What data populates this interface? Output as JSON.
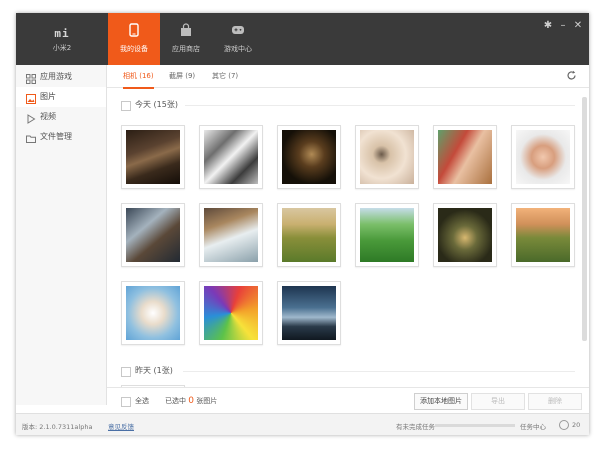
{
  "device": {
    "logo": "mi",
    "name": "小米2"
  },
  "nav": [
    {
      "label": "我的设备",
      "icon": "phone-icon",
      "active": true
    },
    {
      "label": "应用商店",
      "icon": "bag-icon",
      "active": false
    },
    {
      "label": "游戏中心",
      "icon": "gamepad-icon",
      "active": false
    }
  ],
  "window_controls": {
    "settings": "✱",
    "minimize": "–",
    "close": "✕"
  },
  "sidebar": {
    "items": [
      {
        "label": "应用游戏",
        "icon": "apps-grid-icon",
        "active": false
      },
      {
        "label": "图片",
        "icon": "image-icon",
        "active": true
      },
      {
        "label": "视频",
        "icon": "play-icon",
        "active": false
      },
      {
        "label": "文件管理",
        "icon": "folder-icon",
        "active": false
      }
    ]
  },
  "tabs": [
    {
      "label": "相机 (16)",
      "active": true
    },
    {
      "label": "截屏 (9)",
      "active": false
    },
    {
      "label": "其它 (7)",
      "active": false
    }
  ],
  "groups": [
    {
      "label": "今天 (15张)"
    },
    {
      "label": "昨天 (1张)"
    }
  ],
  "actionbar": {
    "select_all": "全选",
    "selected_prefix": "已选中",
    "selected_count": "0",
    "selected_suffix": "张图片",
    "add_local": "添加本地图片",
    "export": "导出",
    "delete": "删除"
  },
  "statusbar": {
    "version": "版本: 2.1.0.7311alpha",
    "feedback": "意见反馈",
    "pending": "有未完成任务",
    "task_center": "任务中心",
    "task_count": "20",
    "progress": 0.0
  },
  "colors": {
    "accent": "#f05a1a",
    "topbar": "#3a3a3a"
  }
}
